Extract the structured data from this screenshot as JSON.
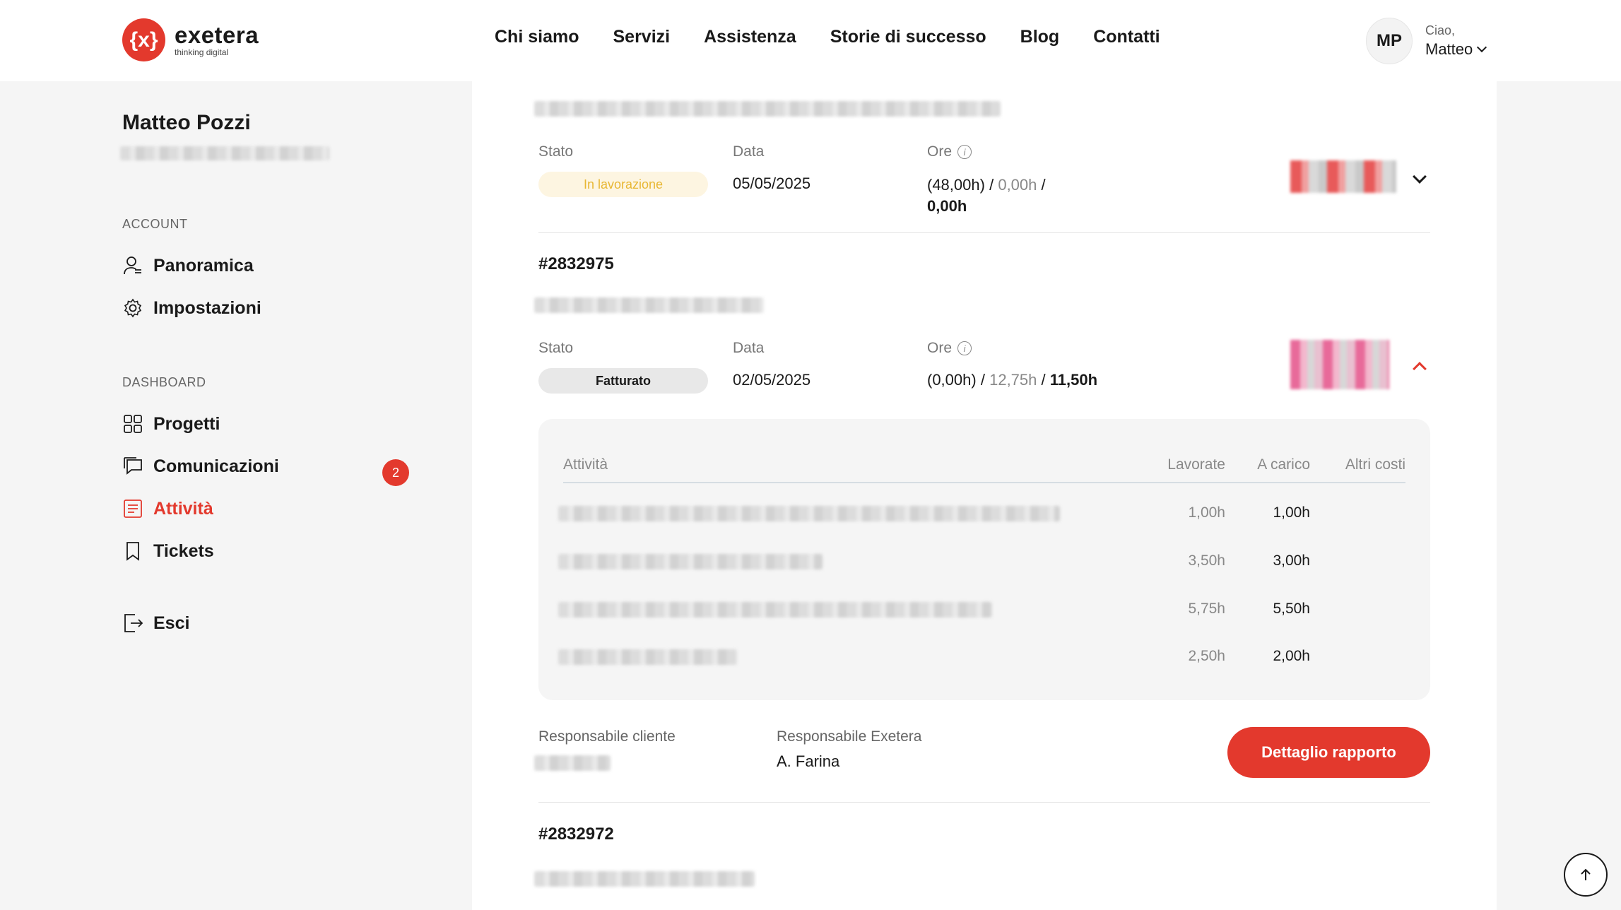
{
  "header": {
    "logo": {
      "mark": "{x}",
      "name": "exetera",
      "tagline": "thinking digital"
    },
    "nav": [
      "Chi siamo",
      "Servizi",
      "Assistenza",
      "Storie di successo",
      "Blog",
      "Contatti"
    ],
    "user": {
      "initials": "MP",
      "greeting": "Ciao,",
      "name": "Matteo"
    }
  },
  "sidebar": {
    "name": "Matteo Pozzi",
    "account_section": "ACCOUNT",
    "account_items": [
      "Panoramica",
      "Impostazioni"
    ],
    "dashboard_section": "DASHBOARD",
    "dashboard_items": [
      "Progetti",
      "Comunicazioni",
      "Attività",
      "Tickets"
    ],
    "tickets_badge": "2",
    "logout": "Esci"
  },
  "main": {
    "labels": {
      "stato": "Stato",
      "data": "Data",
      "ore": "Ore",
      "info": "i"
    },
    "ticket1": {
      "status": "In lavorazione",
      "date": "05/05/2025",
      "hours_a": "(48,00h)",
      "hours_sep1": "/",
      "hours_b": "0,00h",
      "hours_sep2": "/",
      "hours_c": "0,00h"
    },
    "ticket2": {
      "id": "#2832975",
      "status": "Fatturato",
      "date": "02/05/2025",
      "hours_a": "(0,00h)",
      "hours_sep1": "/",
      "hours_b": "12,75h",
      "hours_sep2": "/",
      "hours_c": "11,50h",
      "table": {
        "headers": [
          "Attività",
          "Lavorate",
          "A carico",
          "Altri costi"
        ],
        "rows": [
          {
            "worked": "1,00h",
            "charged": "1,00h"
          },
          {
            "worked": "3,50h",
            "charged": "3,00h"
          },
          {
            "worked": "5,75h",
            "charged": "5,50h"
          },
          {
            "worked": "2,50h",
            "charged": "2,00h"
          }
        ]
      },
      "resp_client_label": "Responsabile cliente",
      "resp_exetera_label": "Responsabile Exetera",
      "resp_exetera_value": "A. Farina",
      "detail_button": "Dettaglio rapporto"
    },
    "ticket3": {
      "id": "#2832972"
    }
  },
  "colors": {
    "accent": "#e3392d",
    "pending": "#e8b733",
    "background": "#f5f5f5"
  },
  "icons": {
    "scroll_top": "arrow-up-icon"
  }
}
